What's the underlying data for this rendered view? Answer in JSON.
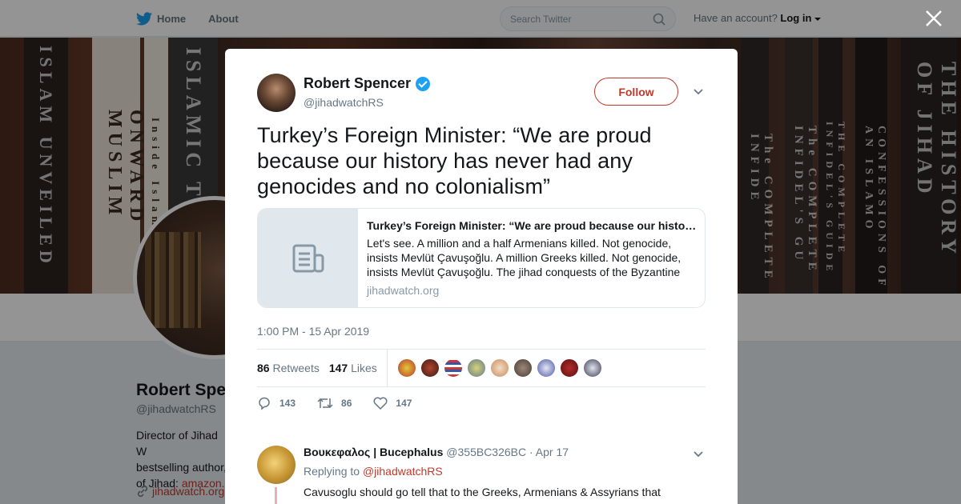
{
  "nav": {
    "home_label": "Home",
    "about_label": "About",
    "search_placeholder": "Search Twitter",
    "account_prompt": "Have an account?",
    "login_label": "Log in"
  },
  "banner": {
    "books": [
      "ISLAM UNVEILED",
      "ONWARD MUSLIM",
      "ISLAMIC TOL",
      "Inside Islam: A Gu",
      "The COMPLETE INFIDE",
      "The COMPLETE INFIDEL'S GU",
      "THE COMPLETE INFIDEL'S GUIDE",
      "CONFESSIONS OF AN ISLAMO",
      "THE HISTORY OF JIHAD"
    ]
  },
  "profile_bg": {
    "name": "Robert Spe",
    "handle": "@jihadwatchRS",
    "bio_line1": "Director of Jihad W",
    "bio_line2": "bestselling author,",
    "bio_line3": "of Jihad: ",
    "bio_link": "amazon.",
    "url": "jihadwatch.org"
  },
  "tweet": {
    "author_name": "Robert Spencer",
    "author_handle": "@jihadwatchRS",
    "follow_label": "Follow",
    "text": "Turkey’s Foreign Minister: “We are proud because our history has never had any genocides and no colonialism”",
    "card": {
      "title": "Turkey’s Foreign Minister: “We are proud because our history has never had any genocides and no colonialism”",
      "description": "Let's see. A million and a half Armenians killed. Not genocide, insists Mevlüt Çavuşoğlu. A million Greeks killed. Not genocide, insists Mevlüt Çavuşoğlu. The jihad conquests of the Byzantine",
      "domain": "jihadwatch.org"
    },
    "timestamp": "1:00 PM - 15 Apr 2019",
    "retweets_count": "86",
    "retweets_label": "Retweets",
    "likes_count": "147",
    "likes_label": "Likes",
    "actions": {
      "replies": "143",
      "retweets": "86",
      "likes": "147"
    }
  },
  "reply": {
    "name": "Βουκεφαλος | Bucephalus",
    "handle": "@355BC326BC",
    "date": "· Apr 17",
    "replying_prefix": "Replying to",
    "replying_to": "@jihadwatchRS",
    "text": "Cavusoglu should go tell that to the Greeks, Armenians & Assyrians that inhabited the Asia Minor region which his Turkish ancestors brutally massacred"
  },
  "colors": {
    "accent": "#c0392b",
    "twitter_blue": "#1da1f2",
    "muted": "#657786"
  }
}
